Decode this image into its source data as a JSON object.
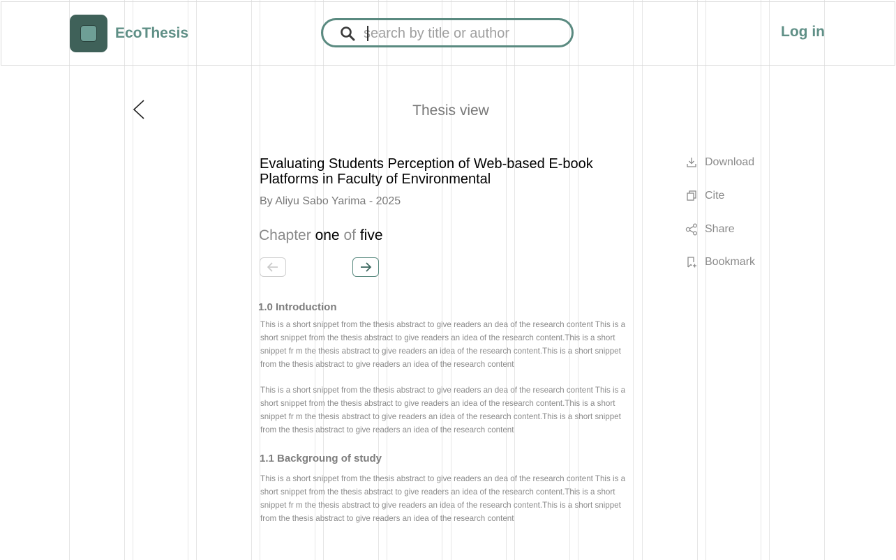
{
  "header": {
    "brand": "EcoThesis",
    "search_placeholder": "search by title or author",
    "search_value": "",
    "login_label": "Log in"
  },
  "page": {
    "title": "Thesis view"
  },
  "thesis": {
    "title": "Evaluating Students Perception of Web-based E-book Platforms in Faculty of Environmental",
    "byline": "By Aliyu Sabo Yarima  - 2025"
  },
  "chapter": {
    "prefix": "Chapter",
    "current": "one",
    "connector": "of",
    "total": "five"
  },
  "content": {
    "section1_heading": "1.0 Introduction",
    "section1_para1": "This is a short snippet from the thesis abstract to give readers  an dea of the research content This is a short snippet from the thesis abstract to give readers  an idea of the research content.This is a short snippet fr m the thesis abstract to give readers  an idea of the research content.This is a short snippet from the thesis abstract to give readers  an idea of the research content",
    "section1_para2": "This is a short snippet from the thesis abstract to give readers  an dea of the research content This is a short snippet from the thesis abstract to give readers  an idea of the research content.This is a short snippet fr m the thesis abstract to give readers  an idea of the research content.This is a short snippet from the thesis abstract to give readers  an idea of the research content",
    "section2_heading": "1.1 Backgroung of study",
    "section2_para1": "This is a short snippet from the thesis abstract to give readers  an dea of the research content This is a short snippet from the thesis abstract to give readers  an idea of the research content.This is a short snippet fr m the thesis abstract to give readers  an idea of the research content.This is a short snippet from the thesis abstract to give readers  an idea of the research content"
  },
  "actions": {
    "download": "Download",
    "cite": "Cite",
    "share": "Share",
    "bookmark": "Bookmark"
  },
  "colors": {
    "brand": "#5f8f86",
    "logo_bg": "#3f6159",
    "search_border": "#5a8a80",
    "text_muted": "#8a8a8a"
  }
}
